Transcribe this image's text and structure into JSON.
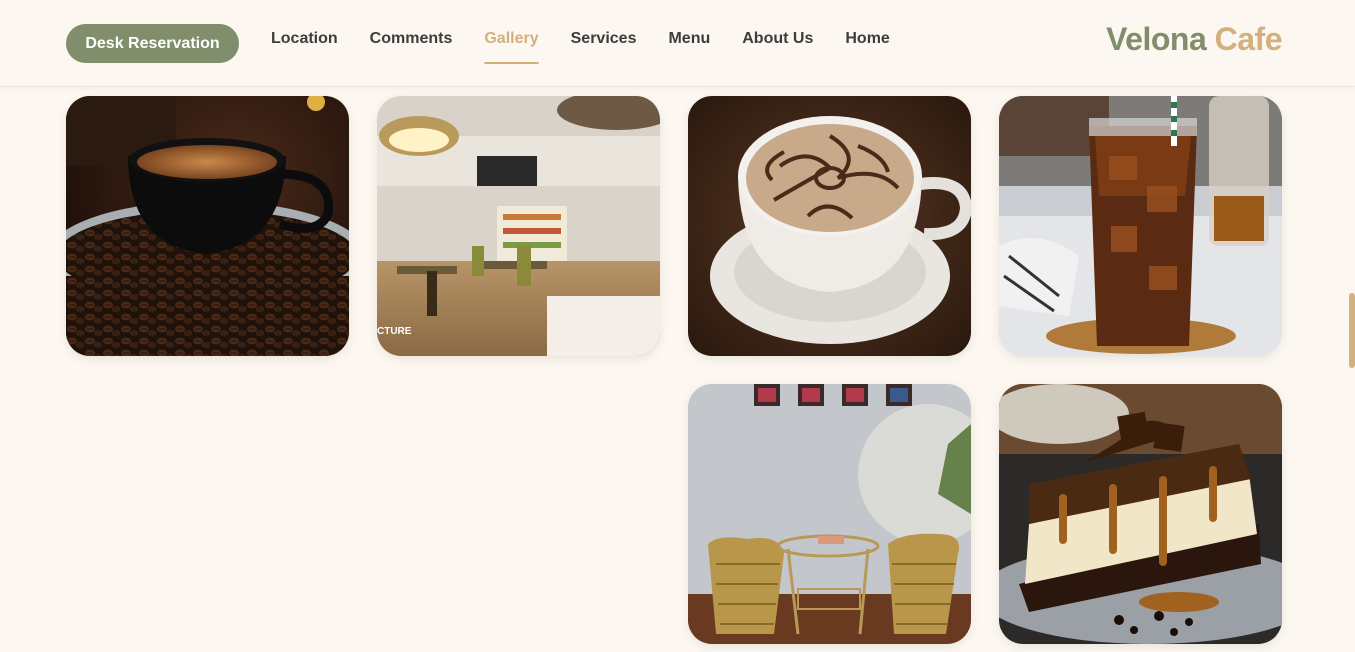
{
  "header": {
    "reserve_button": "Desk Reservation",
    "nav": [
      "Location",
      "Comments",
      "Gallery",
      "Services",
      "Menu",
      "About Us",
      "Home"
    ],
    "active_nav": "Gallery",
    "logo_part1": "Velona",
    "logo_part2": "Cafe"
  },
  "gallery": {
    "images": [
      {
        "subject": "espresso-cup-on-coffee-beans"
      },
      {
        "subject": "cafe-interior"
      },
      {
        "subject": "latte-art-cup"
      },
      {
        "subject": "iced-cola-glass"
      },
      {
        "subject": "rattan-chairs-seating"
      },
      {
        "subject": "chocolate-cheesecake-slice"
      }
    ],
    "watermark_text": "CTURE"
  },
  "colors": {
    "background": "#fcf7f0",
    "accent_green": "#818e6b",
    "accent_gold": "#d4b07e",
    "text_dark": "#3d3d3d"
  }
}
